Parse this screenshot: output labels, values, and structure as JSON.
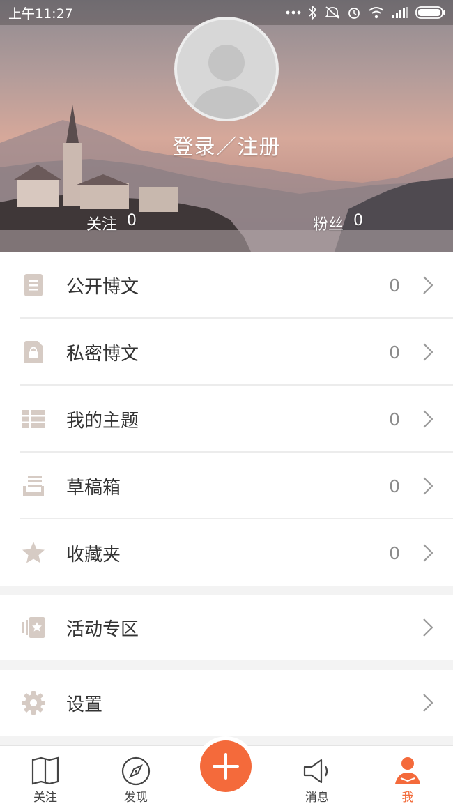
{
  "status_bar": {
    "time": "上午11:27"
  },
  "profile": {
    "login_label": "登录／注册",
    "follow_label": "关注",
    "follow_count": "0",
    "fans_label": "粉丝",
    "fans_count": "0"
  },
  "menu": {
    "public_posts": {
      "label": "公开博文",
      "count": "0",
      "icon": "document-icon"
    },
    "private_posts": {
      "label": "私密博文",
      "count": "0",
      "icon": "lock-document-icon"
    },
    "my_topics": {
      "label": "我的主题",
      "count": "0",
      "icon": "grid-icon"
    },
    "drafts": {
      "label": "草稿箱",
      "count": "0",
      "icon": "drafts-tray-icon"
    },
    "favorites": {
      "label": "收藏夹",
      "count": "0",
      "icon": "star-icon"
    },
    "events": {
      "label": "活动专区",
      "icon": "event-cards-icon"
    },
    "settings": {
      "label": "设置",
      "icon": "gear-icon"
    }
  },
  "tabbar": {
    "follow": "关注",
    "discover": "发现",
    "messages": "消息",
    "me": "我"
  },
  "colors": {
    "accent": "#f46a3b",
    "icon_tint": "#d6cbc4",
    "text": "#333333",
    "muted": "#8c8c8c"
  }
}
